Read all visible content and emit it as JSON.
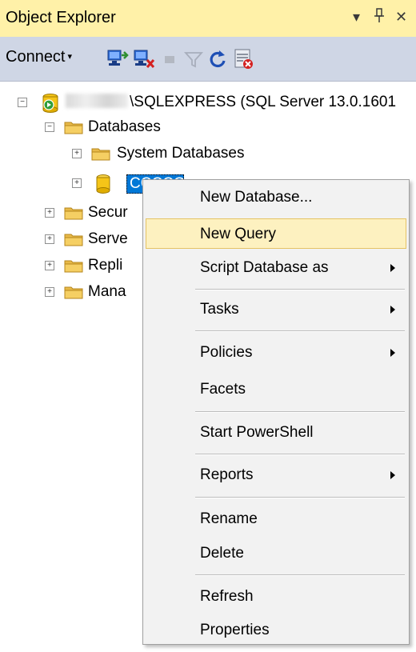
{
  "panel": {
    "title": "Object Explorer",
    "pin_glyph": "ᵾ",
    "dropdown_glyph": "▾",
    "close_glyph": "✕"
  },
  "toolbar": {
    "connect_label": "Connect",
    "connect_dropdown_glyph": "▾",
    "icons": [
      "connect-object-explorer-icon",
      "disconnect-icon",
      "stop-icon",
      "filter-icon",
      "refresh-icon",
      "activity-monitor-icon"
    ]
  },
  "tree": {
    "server_label": "\\SQLEXPRESS (SQL Server 13.0.1601",
    "databases_label": "Databases",
    "system_databases_label": "System Databases",
    "selected_db_label": "CCCCO",
    "other_nodes": [
      "Secur",
      "Serve",
      "Repli",
      "Mana"
    ]
  },
  "context_menu": {
    "items": [
      {
        "label": "New Database...",
        "submenu": false,
        "highlighted": false
      },
      {
        "label": "New Query",
        "submenu": false,
        "highlighted": true
      },
      {
        "label": "Script Database as",
        "submenu": true,
        "highlighted": false
      },
      {
        "label": "Tasks",
        "submenu": true,
        "highlighted": false
      },
      {
        "label": "Policies",
        "submenu": true,
        "highlighted": false
      },
      {
        "label": "Facets",
        "submenu": false,
        "highlighted": false
      },
      {
        "label": "Start PowerShell",
        "submenu": false,
        "highlighted": false
      },
      {
        "label": "Reports",
        "submenu": true,
        "highlighted": false
      },
      {
        "label": "Rename",
        "submenu": false,
        "highlighted": false
      },
      {
        "label": "Delete",
        "submenu": false,
        "highlighted": false
      },
      {
        "label": "Refresh",
        "submenu": false,
        "highlighted": false
      },
      {
        "label": "Properties",
        "submenu": false,
        "highlighted": false
      }
    ]
  },
  "colors": {
    "titlebar_bg": "#fff1a8",
    "toolbar_bg": "#cfd6e5",
    "selection_bg": "#0078d7",
    "menu_highlight_bg": "#fdf1c0",
    "menu_highlight_border": "#e5c365"
  }
}
